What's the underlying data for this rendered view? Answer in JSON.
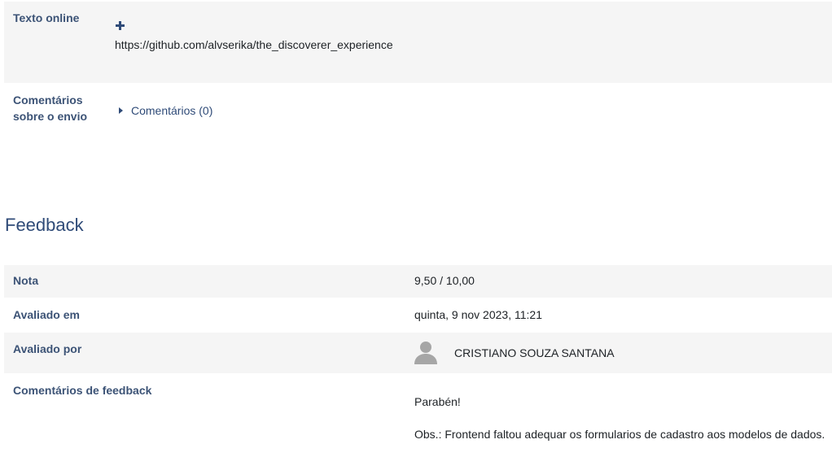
{
  "submission": {
    "online_text_label": "Texto online",
    "online_text_value": "https://github.com/alvserika/the_discoverer_experience",
    "comments_label_line1": "Comentários",
    "comments_label_line2": "sobre o envio",
    "comments_toggle": "Comentários (0)"
  },
  "feedback": {
    "heading": "Feedback",
    "grade_label": "Nota",
    "grade_value": "9,50 / 10,00",
    "graded_on_label": "Avaliado em",
    "graded_on_value": "quinta, 9 nov 2023, 11:21",
    "graded_by_label": "Avaliado por",
    "graded_by_value": "CRISTIANO SOUZA SANTANA",
    "comments_label": "Comentários de feedback",
    "comments_line1": "Parabén!",
    "comments_line2": "Obs.: Frontend faltou adequar os formularios de cadastro aos modelos de dados."
  },
  "icons": {
    "expand": "plus-icon",
    "toggle": "caret-right-icon",
    "user": "user-avatar-icon"
  },
  "colors": {
    "label": "#3c5376",
    "heading": "#2f4b78",
    "row_bg": "#f5f5f5"
  }
}
